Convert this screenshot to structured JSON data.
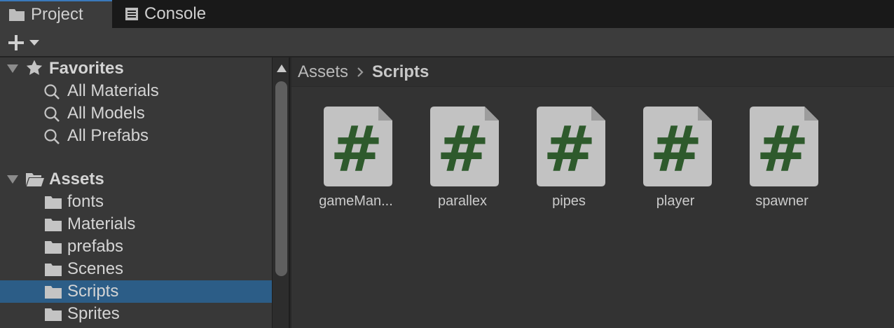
{
  "tabs": [
    {
      "label": "Project",
      "icon": "folder-icon",
      "active": true
    },
    {
      "label": "Console",
      "icon": "console-icon",
      "active": false
    }
  ],
  "toolbar": {
    "add_icon": "plus-icon",
    "dropdown_icon": "caret-down-icon"
  },
  "favorites": {
    "label": "Favorites",
    "icon": "star-icon",
    "items": [
      {
        "label": "All Materials",
        "icon": "search-icon"
      },
      {
        "label": "All Models",
        "icon": "search-icon"
      },
      {
        "label": "All Prefabs",
        "icon": "search-icon"
      }
    ]
  },
  "assets": {
    "label": "Assets",
    "icon": "open-folder-icon",
    "folders": [
      {
        "label": "fonts",
        "selected": false
      },
      {
        "label": "Materials",
        "selected": false
      },
      {
        "label": "prefabs",
        "selected": false
      },
      {
        "label": "Scenes",
        "selected": false
      },
      {
        "label": "Scripts",
        "selected": true
      },
      {
        "label": "Sprites",
        "selected": false
      }
    ]
  },
  "breadcrumb": {
    "root": "Assets",
    "current": "Scripts"
  },
  "files": [
    {
      "name": "gameMan...",
      "icon": "csharp-script-icon"
    },
    {
      "name": "parallex",
      "icon": "csharp-script-icon"
    },
    {
      "name": "pipes",
      "icon": "csharp-script-icon"
    },
    {
      "name": "player",
      "icon": "csharp-script-icon"
    },
    {
      "name": "spawner",
      "icon": "csharp-script-icon"
    }
  ],
  "colors": {
    "selection": "#2c5d87",
    "active_tab_accent": "#3a79bb",
    "script_hash": "#2e5a2c",
    "script_page": "#c2c2c2"
  }
}
